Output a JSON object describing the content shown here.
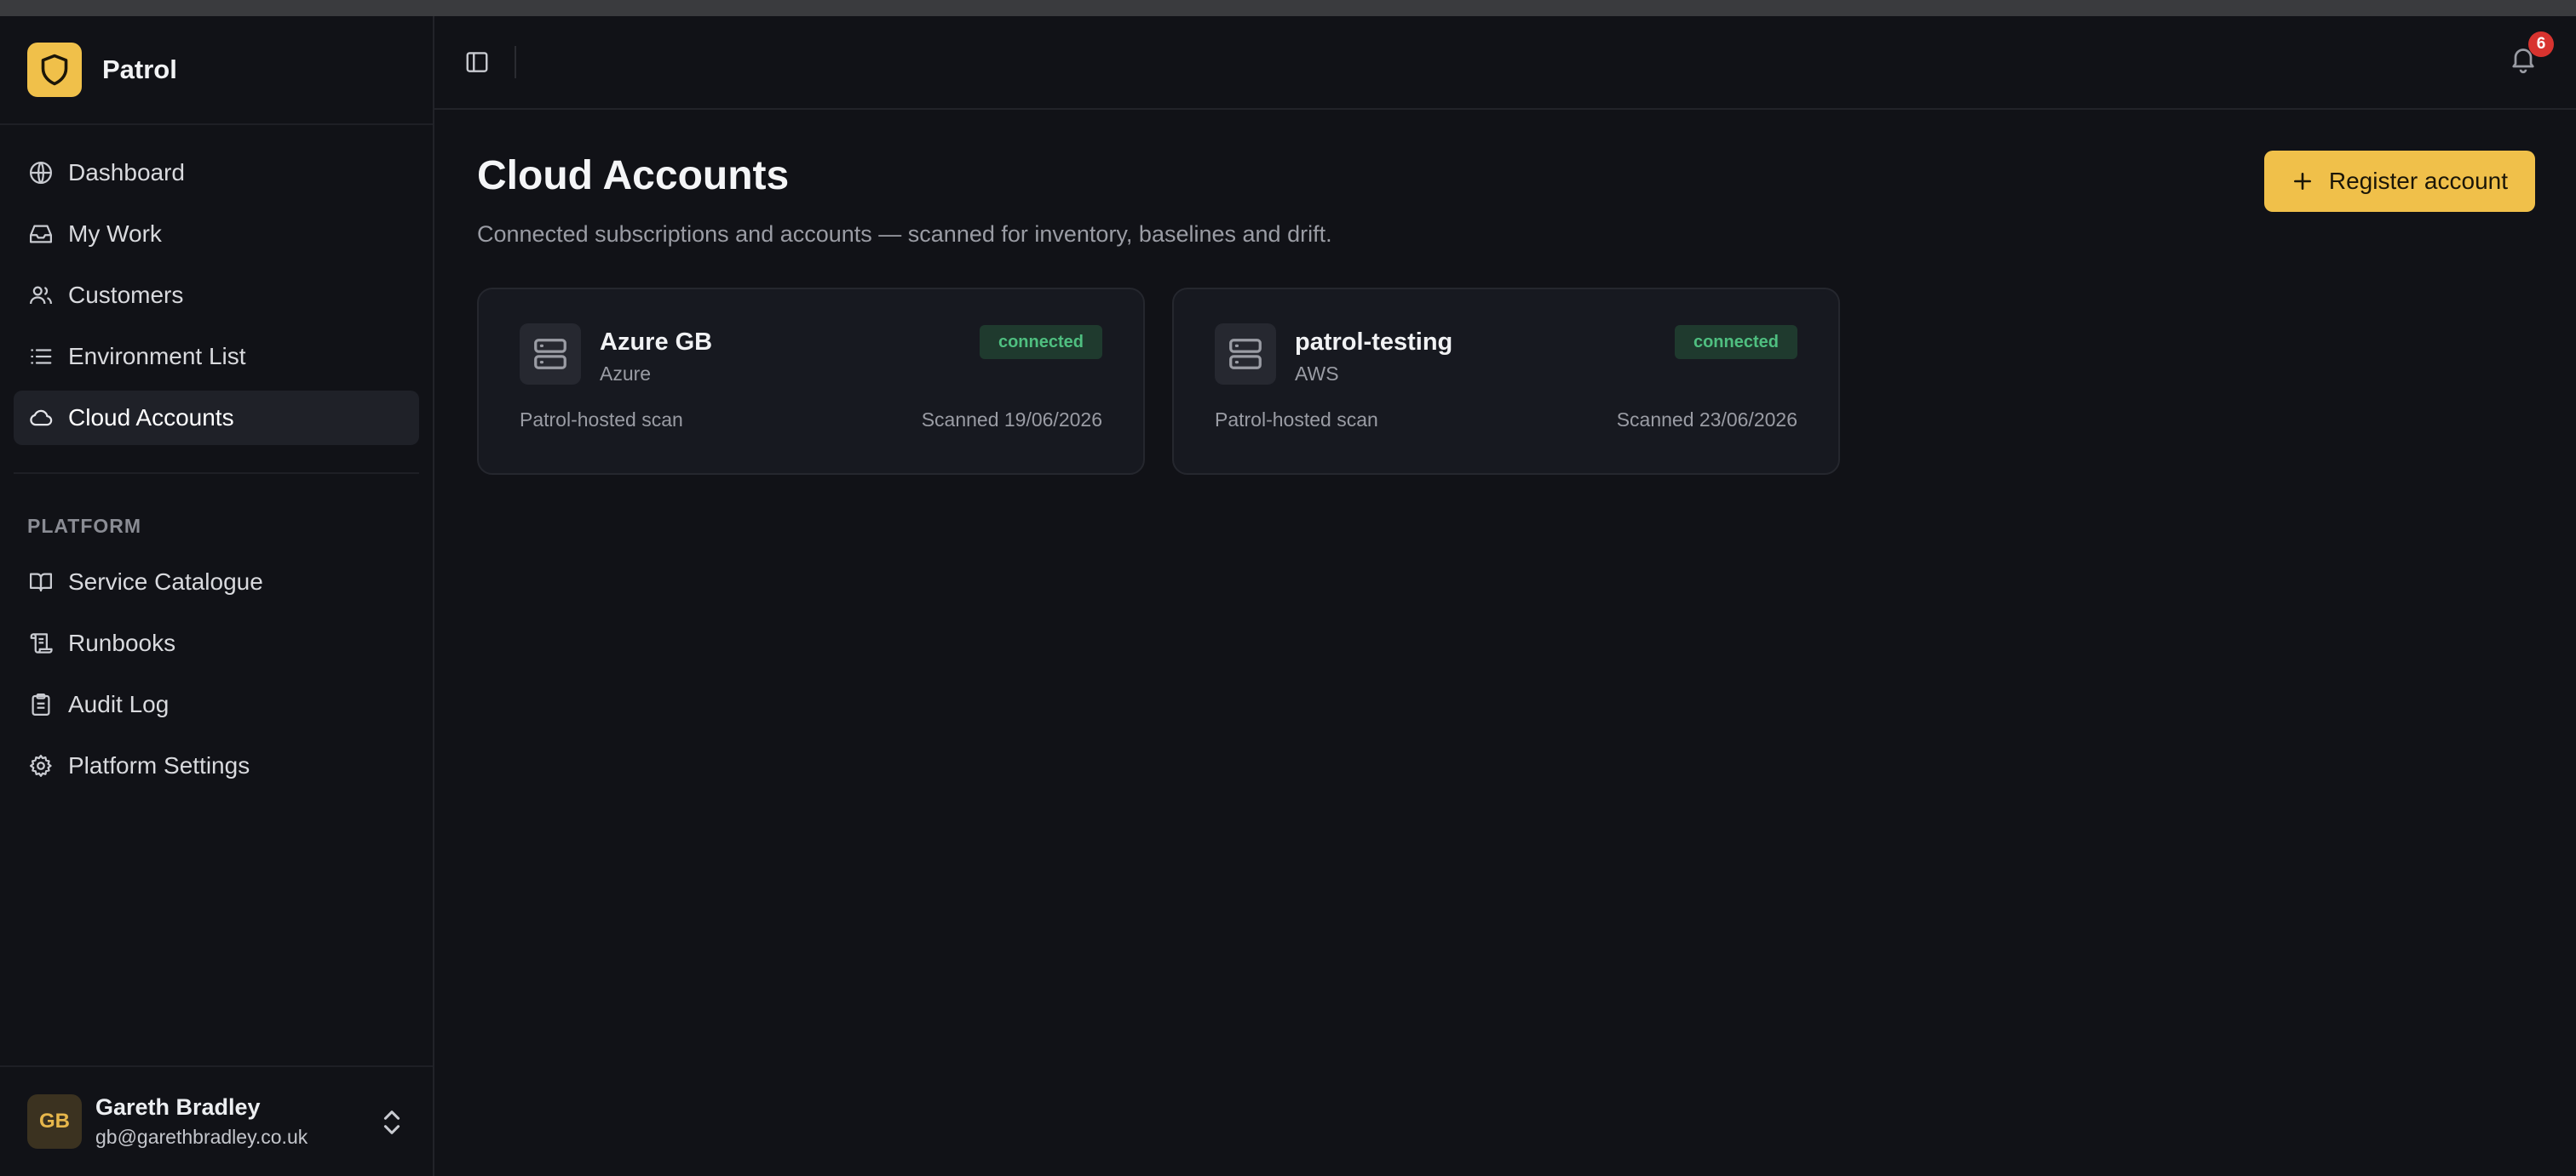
{
  "app": {
    "name": "Patrol"
  },
  "nav": {
    "items": [
      {
        "label": "Dashboard",
        "icon": "globe-icon"
      },
      {
        "label": "My Work",
        "icon": "inbox-icon"
      },
      {
        "label": "Customers",
        "icon": "users-icon"
      },
      {
        "label": "Environment List",
        "icon": "list-icon"
      },
      {
        "label": "Cloud Accounts",
        "icon": "cloud-icon",
        "active": true
      }
    ],
    "platform_label": "PLATFORM",
    "platform_items": [
      {
        "label": "Service Catalogue",
        "icon": "book-icon"
      },
      {
        "label": "Runbooks",
        "icon": "scroll-icon"
      },
      {
        "label": "Audit Log",
        "icon": "clipboard-icon"
      },
      {
        "label": "Platform Settings",
        "icon": "gear-icon"
      }
    ]
  },
  "user": {
    "initials": "GB",
    "name": "Gareth Bradley",
    "email": "gb@garethbradley.co.uk"
  },
  "header": {
    "notifications_count": "6"
  },
  "page": {
    "title": "Cloud Accounts",
    "subtitle": "Connected subscriptions and accounts — scanned for inventory, baselines and drift.",
    "register_label": "Register account"
  },
  "accounts": [
    {
      "name": "Azure GB",
      "provider": "Azure",
      "status": "connected",
      "scan_type": "Patrol-hosted scan",
      "scanned": "Scanned 19/06/2026"
    },
    {
      "name": "patrol-testing",
      "provider": "AWS",
      "status": "connected",
      "scan_type": "Patrol-hosted scan",
      "scanned": "Scanned 23/06/2026"
    }
  ],
  "colors": {
    "accent": "#f0c04a",
    "status_connected": "#4fbf80",
    "background": "#111217"
  }
}
